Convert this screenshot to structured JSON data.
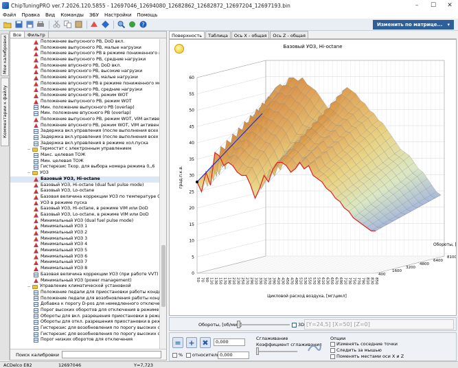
{
  "window": {
    "title": "ChipTuningPRO ver.7.2026.120.5855 - 12697046_12694080_12682862_12682872_12697204_12697193.bin",
    "minimize": "–",
    "maximize": "☐",
    "close": "✕"
  },
  "menu": [
    "Файл",
    "Правка",
    "Вид",
    "Команды",
    "ЭБУ",
    "Настройки",
    "Помощь"
  ],
  "toolbar": {
    "matrix_button": "Изменить по матрице...",
    "matrix_arrow": "▾"
  },
  "side_tabs": [
    "Мои калибровки",
    "Комментарии к файлу"
  ],
  "left_tabs": [
    "Все",
    "Фильтр"
  ],
  "tree": [
    {
      "icon": "map",
      "text": "Положение выпускного РВ, DoD вкл."
    },
    {
      "icon": "map",
      "text": "Положение выпускного РВ, малые нагрузки"
    },
    {
      "icon": "map",
      "text": "Положение выпускного РВ в режиме пониженного мом"
    },
    {
      "icon": "map",
      "text": "Положение выпускного РВ, средние нагрузки"
    },
    {
      "icon": "map",
      "text": "Положение впускного РВ, DoD вкл."
    },
    {
      "icon": "map",
      "text": "Положение впускного РВ, высокие нагрузки"
    },
    {
      "icon": "map",
      "text": "Положение впускного РВ, малые нагрузки"
    },
    {
      "icon": "map",
      "text": "Положение впускного РВ в режиме пониженного моме"
    },
    {
      "icon": "map",
      "text": "Положение впускного РВ, средние нагрузки"
    },
    {
      "icon": "map",
      "text": "Положение впускного РВ, режим WOT"
    },
    {
      "icon": "map",
      "text": "Положение выпускного РВ, режим WOT"
    },
    {
      "icon": "tbl",
      "text": "Мин. положение выпускного РВ (overlap)"
    },
    {
      "icon": "tbl",
      "text": "Мин. положение впускного РВ (overlap)"
    },
    {
      "icon": "map",
      "text": "Положение выпускного РВ, режим WOT, VIM активен"
    },
    {
      "icon": "map",
      "text": "Положение впускного РВ, режим WOT, VIM активен"
    },
    {
      "icon": "tbl",
      "text": "Задержка вкл.управления (после выполнения всех усл"
    },
    {
      "icon": "tbl",
      "text": "Задержка вкл.управления (после выполнения всех усл"
    },
    {
      "icon": "tbl",
      "text": "Задержка вкл.управления в режиме хол.пуска"
    },
    {
      "icon": "folder",
      "text": "Термостат с электронным управлением",
      "expand": "−"
    },
    {
      "icon": "tbl",
      "text": "Макс. целевая ТОЖ"
    },
    {
      "icon": "tbl",
      "text": "Мин. целевая ТОЖ"
    },
    {
      "icon": "tbl",
      "text": "Гистерезис Ткор. для выбора номера режима 0,,6"
    },
    {
      "icon": "folder",
      "text": "УОЗ",
      "expand": "−"
    },
    {
      "icon": "map",
      "text": "Базовый УОЗ, Hi-octane",
      "selected": true
    },
    {
      "icon": "map",
      "text": "Базовый УОЗ, Hi-octane (dual fuel pulse mode)"
    },
    {
      "icon": "map",
      "text": "Базовый УОЗ, Lo-octane"
    },
    {
      "icon": "map",
      "text": "Базовая величина коррекции УОЗ по температуре ОЖ"
    },
    {
      "icon": "map",
      "text": "УОЗ в режиме пуска"
    },
    {
      "icon": "map",
      "text": "Базовый УОЗ, Hi-octane, в режиме VIM или DoD"
    },
    {
      "icon": "map",
      "text": "Базовый УОЗ, Lo-octane, в режиме VIM или DoD"
    },
    {
      "icon": "map",
      "text": "Минимальный УОЗ (dual fuel pulse mode)"
    },
    {
      "icon": "map",
      "text": "Минимальный УОЗ 1"
    },
    {
      "icon": "map",
      "text": "Минимальный УОЗ 2"
    },
    {
      "icon": "map",
      "text": "Минимальный УОЗ 3"
    },
    {
      "icon": "map",
      "text": "Минимальный УОЗ 4"
    },
    {
      "icon": "map",
      "text": "Минимальный УОЗ 5"
    },
    {
      "icon": "map",
      "text": "Минимальный УОЗ 6"
    },
    {
      "icon": "map",
      "text": "Минимальный УОЗ 7"
    },
    {
      "icon": "map",
      "text": "Минимальный УОЗ 8"
    },
    {
      "icon": "tbl",
      "text": "Базовая величина коррекции УОЗ (при работе VVT)"
    },
    {
      "icon": "map",
      "text": "Минимальный УОЗ (power management)"
    },
    {
      "icon": "folder",
      "text": "Управление климатической установкой",
      "expand": "−"
    },
    {
      "icon": "tbl",
      "text": "Положение педали для приостановки работы кондици"
    },
    {
      "icon": "tbl",
      "text": "Положение педали для возобновления работы кондиц"
    },
    {
      "icon": "tbl",
      "text": "Добавка к порогу D-pos для немедленного отключения"
    },
    {
      "icon": "tbl",
      "text": "Порог высоких оборотов для отключения в режиме Р/"
    },
    {
      "icon": "tbl",
      "text": "Обороты для вкл. разрешения приостановки в режиме"
    },
    {
      "icon": "tbl",
      "text": "Обороты для откл. разрешения приостановки в режиме"
    },
    {
      "icon": "tbl",
      "text": "Гистерезис для возобновления по порогу высоких обо"
    },
    {
      "icon": "tbl",
      "text": "Гистерезис для возобновления по порогу высоких обо"
    },
    {
      "icon": "tbl",
      "text": "Порог низких оборотов для отключения"
    }
  ],
  "search": {
    "label": "Поиск калибровки"
  },
  "right_tabs": [
    "Поверхность",
    "Таблица",
    "Ось X - общая",
    "Ось Z - общая"
  ],
  "chart_data": {
    "type": "surface3d",
    "title": "Базовый УОЗ, Hi-octane",
    "xlabel": "Цикловой расход воздуха, [мг/цикл]",
    "ylabel": "град.п.к.в.",
    "zlabel": "Обороты, [об/мин]",
    "y_ticks": [
      "0",
      "5",
      "10",
      "15",
      "20",
      "25",
      "30",
      "35",
      "40",
      "45",
      "50",
      "55",
      "60"
    ],
    "x_ticks": [
      "50",
      "70",
      "90",
      "110",
      "130",
      "150",
      "170",
      "190",
      "210",
      "230",
      "250",
      "270",
      "290",
      "310",
      "330",
      "350",
      "370",
      "390",
      "410",
      "430",
      "450",
      "470",
      "490",
      "510",
      "530",
      "550",
      "570",
      "590",
      "610",
      "630",
      "650",
      "670",
      "690",
      "710",
      "730",
      "750",
      "770",
      "790",
      "810",
      "830",
      "850"
    ],
    "z_ticks": [
      "400",
      "1600",
      "3200",
      "4800",
      "6400",
      "8100"
    ],
    "ylim": [
      0,
      60
    ],
    "profile_front": [
      28,
      25,
      31,
      27,
      37,
      36,
      33,
      34,
      33,
      31,
      30,
      30,
      27,
      23,
      26,
      30,
      28,
      32,
      34,
      34,
      33,
      31,
      32,
      34,
      32,
      33,
      30,
      29,
      28,
      26,
      25,
      23,
      22,
      20,
      19,
      17,
      16,
      15,
      14,
      13,
      13
    ],
    "profile_back": [
      44,
      39,
      50,
      52,
      53,
      52,
      55,
      55,
      54,
      55,
      53,
      52,
      51,
      49,
      47,
      45,
      43,
      45,
      51,
      52,
      51,
      50,
      48,
      47,
      45,
      44,
      42,
      41,
      39,
      37,
      35,
      33,
      32,
      31,
      29,
      27,
      26,
      24,
      22,
      20,
      19
    ]
  },
  "controls": {
    "rpm_label": "Обороты, [об/мин]",
    "check_3d": "3D",
    "coords": "[Y=24,5] [X=50] [Z=0]",
    "percent_label": "%",
    "relative_label": "относительно",
    "value1": "0,000",
    "value2": "0,000",
    "smoothing_title": "Сглаживание",
    "smoothing_label": "Коэффициент сглаживания",
    "options_title": "Опции",
    "opt1": "Изменять соседние точки",
    "opt2": "Следить за мышью",
    "opt3": "Поменять местами оси X и Z"
  },
  "status": {
    "ecu": "ACDelco E82",
    "id": "12697046",
    "y": "Y=7,723"
  }
}
